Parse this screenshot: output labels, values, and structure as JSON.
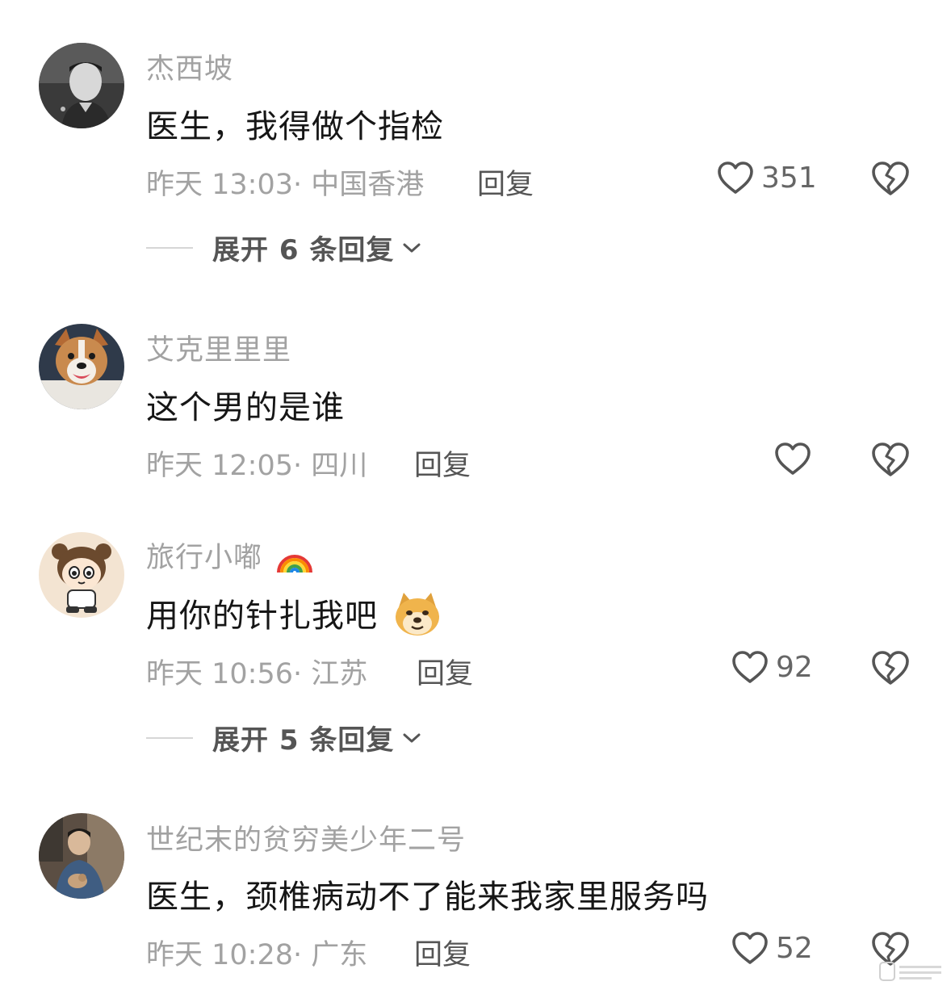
{
  "comments": [
    {
      "username": "杰西坡",
      "text": "医生，我得做个指检",
      "time": "昨天 13:03",
      "location": "中国香港",
      "reply_label": "回复",
      "likes": "351",
      "expand_label": "展开 6 条回复",
      "avatar_icon": "bw-portrait-avatar"
    },
    {
      "username": "艾克里里里",
      "text": "这个男的是谁",
      "time": "昨天 12:05",
      "location": "四川",
      "reply_label": "回复",
      "likes": "",
      "avatar_icon": "dog-avatar"
    },
    {
      "username": "旅行小嘟",
      "username_emoji": "rainbow-icon",
      "text": "用你的针扎我吧",
      "text_emoji": "doge-icon",
      "time": "昨天 10:56",
      "location": "江苏",
      "reply_label": "回复",
      "likes": "92",
      "expand_label": "展开 5 条回复",
      "avatar_icon": "cartoon-avatar"
    },
    {
      "username": "世纪末的贫穷美少年二号",
      "text": "医生，颈椎病动不了能来我家里服务吗",
      "time": "昨天 10:28",
      "location": "广东",
      "reply_label": "回复",
      "likes": "52",
      "avatar_icon": "photo-avatar"
    }
  ],
  "meta_separator": "· ",
  "colors": {
    "secondary_text": "#a2a2a2",
    "primary_text": "#161616",
    "icon_stroke": "#555555"
  }
}
